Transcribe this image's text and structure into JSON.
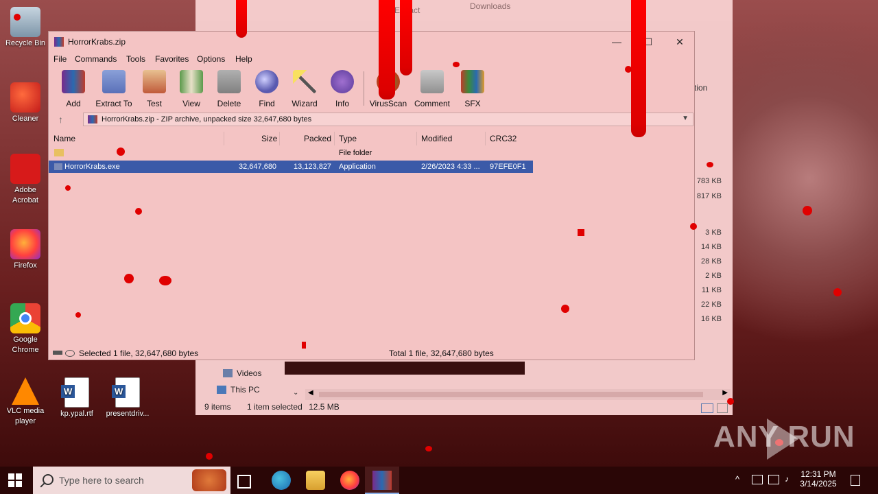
{
  "desktop": {
    "icons": [
      {
        "label": "Recycle Bin",
        "icon": "recycle-bin-icon"
      },
      {
        "label": "Cleaner",
        "icon": "ccleaner-icon"
      },
      {
        "label": "Adobe Acrobat",
        "icon": "acrobat-icon"
      },
      {
        "label": "Firefox",
        "icon": "firefox-icon"
      },
      {
        "label": "Google Chrome",
        "icon": "chrome-icon"
      },
      {
        "label": "VLC media player",
        "icon": "vlc-icon"
      },
      {
        "label": "kp.ypal.rtf",
        "icon": "word-doc-icon"
      },
      {
        "label": "presentdriv...",
        "icon": "word-doc-icon"
      }
    ],
    "watermark": "ANY RUN"
  },
  "explorer": {
    "title_center": "Extract",
    "title_right": "Downloads",
    "partial_text": "tion",
    "sizes": [
      "783 KB",
      "817 KB",
      "3 KB",
      "14 KB",
      "28 KB",
      "2 KB",
      "11 KB",
      "22 KB",
      "16 KB"
    ],
    "nav_items": [
      "Videos",
      "This PC"
    ],
    "status_items": "9 items",
    "status_selected": "1 item selected",
    "status_size": "12.5 MB"
  },
  "winrar": {
    "title": "HorrorKrabs.zip",
    "menu": [
      "File",
      "Commands",
      "Tools",
      "Favorites",
      "Options",
      "Help"
    ],
    "toolbar": [
      {
        "label": "Add",
        "icon": "add-archive-icon"
      },
      {
        "label": "Extract To",
        "icon": "extract-folder-icon"
      },
      {
        "label": "Test",
        "icon": "test-clipboard-icon"
      },
      {
        "label": "View",
        "icon": "view-book-icon"
      },
      {
        "label": "Delete",
        "icon": "trash-icon"
      },
      {
        "label": "Find",
        "icon": "magnifier-icon"
      },
      {
        "label": "Wizard",
        "icon": "magic-wand-icon"
      },
      {
        "label": "Info",
        "icon": "info-icon"
      },
      {
        "label": "VirusScan",
        "icon": "virus-scan-icon"
      },
      {
        "label": "Comment",
        "icon": "comment-icon"
      },
      {
        "label": "SFX",
        "icon": "sfx-box-icon"
      }
    ],
    "address": "HorrorKrabs.zip - ZIP archive, unpacked size 32,647,680 bytes",
    "columns": [
      "Name",
      "Size",
      "Packed",
      "Type",
      "Modified",
      "CRC32"
    ],
    "rows": [
      {
        "name": "",
        "size": "",
        "packed": "",
        "type": "File folder",
        "modified": "",
        "crc": ""
      },
      {
        "name": "HorrorKrabs.exe",
        "size": "32,647,680",
        "packed": "13,123,827",
        "type": "Application",
        "modified": "2/26/2023 4:33 ...",
        "crc": "97EFE0F1"
      }
    ],
    "status_left": "Selected 1 file, 32,647,680 bytes",
    "status_right": "Total 1 file, 32,647,680 bytes"
  },
  "taskbar": {
    "search_placeholder": "Type here to search",
    "time": "12:31 PM",
    "date": "3/14/2025"
  },
  "colors": {
    "selection": "#3b5aa8",
    "blood": "#e00000",
    "window_tint": "#f4c4c4"
  }
}
